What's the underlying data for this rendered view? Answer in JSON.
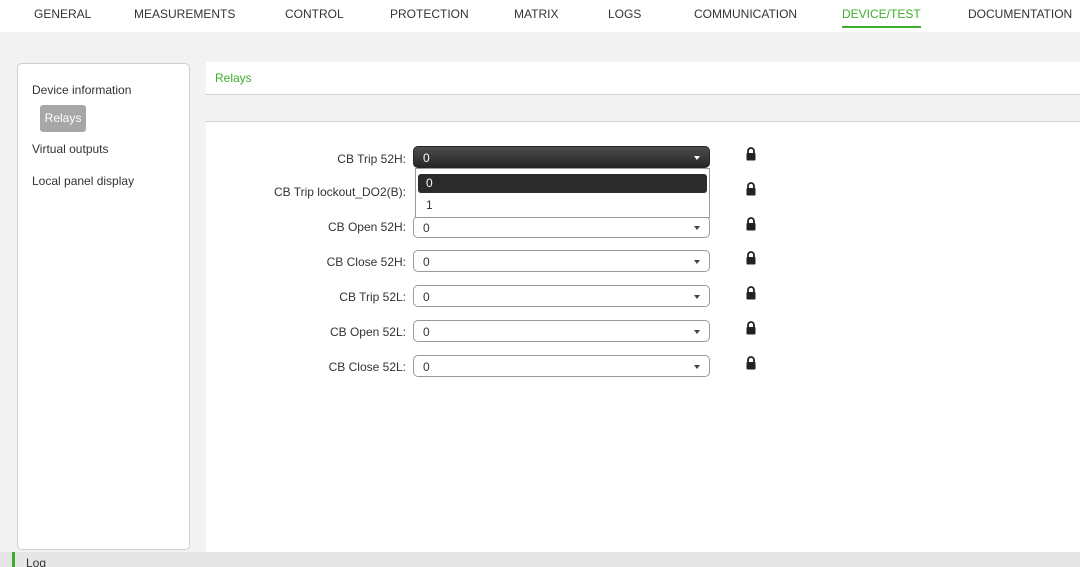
{
  "nav": {
    "items": [
      "GENERAL",
      "MEASUREMENTS",
      "CONTROL",
      "PROTECTION",
      "MATRIX",
      "LOGS",
      "COMMUNICATION",
      "DEVICE/TEST",
      "DOCUMENTATION"
    ],
    "active": "DEVICE/TEST"
  },
  "sidebar": {
    "items": [
      "Device information",
      "Relays",
      "Virtual outputs",
      "Local panel display"
    ],
    "active": "Relays"
  },
  "main": {
    "title": "Relays",
    "rows": [
      {
        "label": "CB Trip 52H:",
        "value": "0"
      },
      {
        "label": "CB Trip lockout_DO2(B):",
        "value": "0"
      },
      {
        "label": "CB Open 52H:",
        "value": "0"
      },
      {
        "label": "CB Close 52H:",
        "value": "0"
      },
      {
        "label": "CB Trip 52L:",
        "value": "0"
      },
      {
        "label": "CB Open 52L:",
        "value": "0"
      },
      {
        "label": "CB Close 52L:",
        "value": "0"
      }
    ],
    "dropdown": {
      "options": [
        "0",
        "1"
      ],
      "selected": "0"
    }
  },
  "log": {
    "label": "Log"
  },
  "colors": {
    "accent": "#3dae2b",
    "sidebar_active": "#a7a7a7",
    "dark": "#2b2b2b"
  },
  "icons": {
    "row_icon": "padlock-icon",
    "caret": "chevron-down-icon"
  }
}
